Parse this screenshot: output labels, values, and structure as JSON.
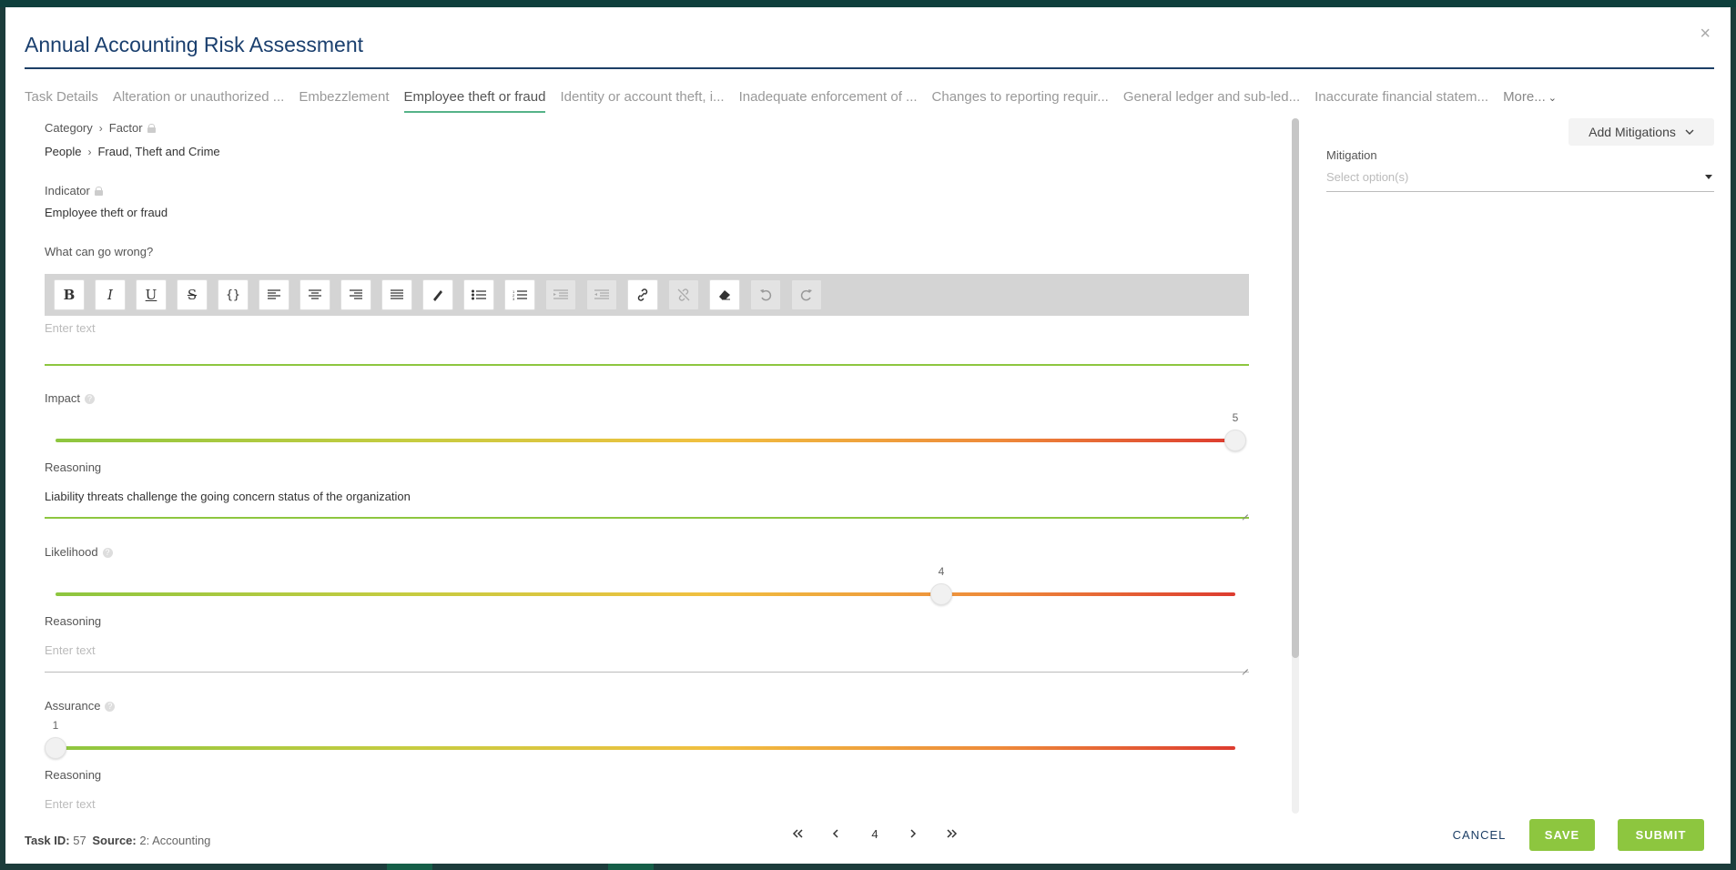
{
  "title": "Annual Accounting Risk Assessment",
  "close_glyph": "×",
  "tabs": [
    {
      "label": "Task Details"
    },
    {
      "label": "Alteration or unauthorized ..."
    },
    {
      "label": "Embezzlement"
    },
    {
      "label": "Employee theft or fraud"
    },
    {
      "label": "Identity or account theft, i..."
    },
    {
      "label": "Inadequate enforcement of ..."
    },
    {
      "label": "Changes to reporting requir..."
    },
    {
      "label": "General ledger and sub-led..."
    },
    {
      "label": "Inaccurate financial statem..."
    },
    {
      "label": "More..."
    }
  ],
  "active_tab": "Employee theft or fraud",
  "category": {
    "label": "Category",
    "factor_label": "Factor",
    "value": "People",
    "factor_value": "Fraud, Theft and Crime"
  },
  "indicator": {
    "label": "Indicator",
    "value": "Employee theft or fraud"
  },
  "what_can_go_wrong": {
    "label": "What can go wrong?",
    "placeholder": "Enter text",
    "toolbar": [
      "bold",
      "italic",
      "underline",
      "strikethrough",
      "code",
      "align-left",
      "align-center",
      "align-right",
      "align-justify",
      "highlight",
      "bullet-list",
      "numbered-list",
      "outdent",
      "indent",
      "link",
      "unlink",
      "clear-format",
      "undo",
      "redo"
    ],
    "toolbar_disabled": [
      "outdent",
      "indent",
      "unlink",
      "undo",
      "redo"
    ]
  },
  "impact": {
    "label": "Impact",
    "value": "5",
    "min": 1,
    "max": 5,
    "reasoning_label": "Reasoning",
    "reasoning": "Liability threats challenge the going concern status of the organization"
  },
  "likelihood": {
    "label": "Likelihood",
    "value": "4",
    "min": 1,
    "max": 5,
    "reasoning_label": "Reasoning",
    "reasoning_placeholder": "Enter text"
  },
  "assurance": {
    "label": "Assurance",
    "value": "1",
    "min": 1,
    "max": 5,
    "reasoning_label": "Reasoning",
    "reasoning_placeholder": "Enter text"
  },
  "mitigation": {
    "add_button": "Add Mitigations",
    "label": "Mitigation",
    "placeholder": "Select option(s)"
  },
  "footer": {
    "task_id_label": "Task ID:",
    "task_id": "57",
    "source_label": "Source:",
    "source": "2: Accounting",
    "page": "4",
    "cancel": "CANCEL",
    "save": "SAVE",
    "submit": "SUBMIT"
  },
  "colors": {
    "accent_green": "#8dc63f",
    "title_blue": "#1a3f6e",
    "tab_underline": "#55b388",
    "slider_low": "#8dc63f",
    "slider_high": "#dd3b2f"
  }
}
